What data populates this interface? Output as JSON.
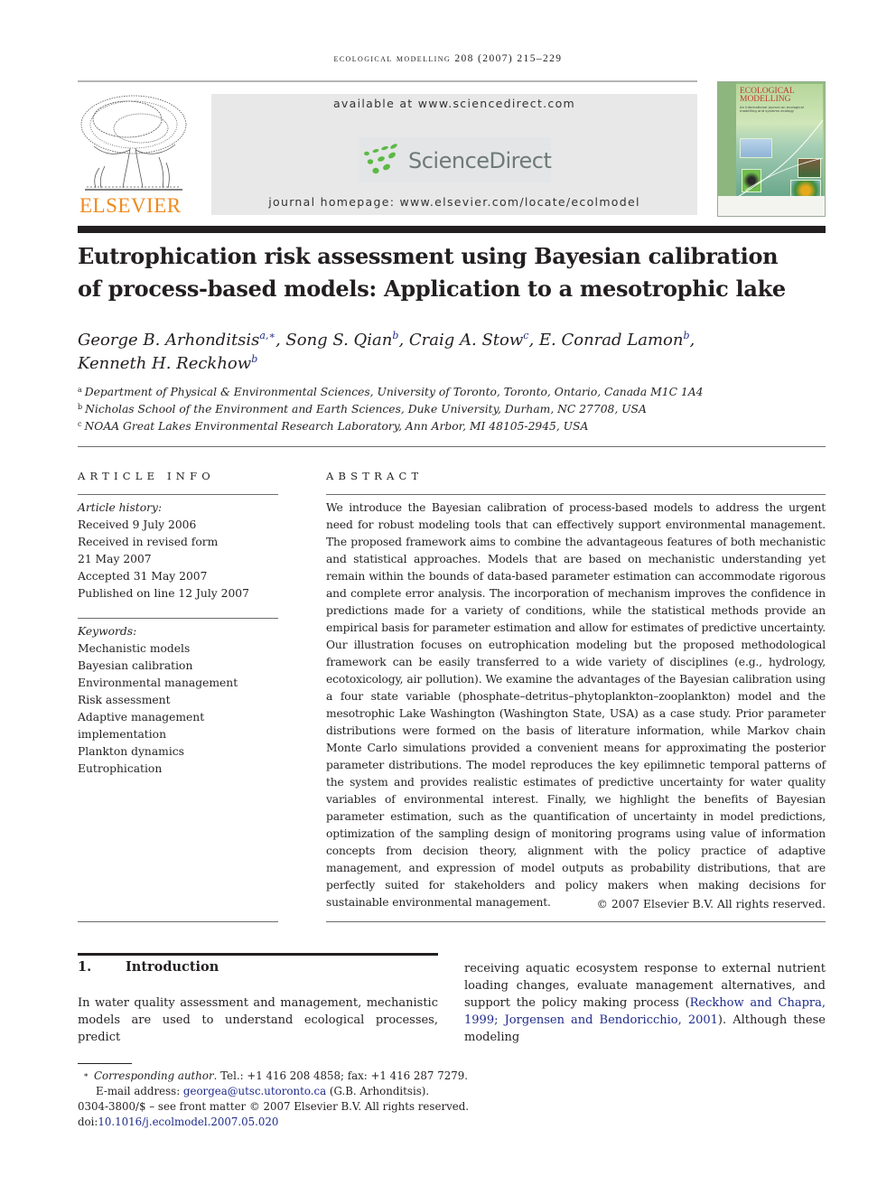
{
  "running_head": "ecological modelling 208 (2007) 215–229",
  "header": {
    "publisher": "ELSEVIER",
    "available_at": "available at www.sciencedirect.com",
    "sciencedirect_logo": "ScienceDirect",
    "journal_homepage": "journal homepage: www.elsevier.com/locate/ecolmodel",
    "cover": {
      "title_line1": "ECOLOGICAL",
      "title_line2": "MODELLING",
      "subtitle": "An international journal on ecological modelling and systems ecology"
    }
  },
  "colors": {
    "elsevier_orange": "#f08a1c",
    "sciencedirect_green": "#5cb946",
    "sciencedirect_gray": "#6f7a77",
    "link_blue": "#1e2a8a",
    "text": "#231f20"
  },
  "article": {
    "title_line1": "Eutrophication risk assessment using Bayesian calibration",
    "title_line2": "of process-based models: Application to a mesotrophic lake",
    "authors": [
      {
        "name": "George B. Arhonditsis",
        "sup": "a,∗",
        "sep": ", "
      },
      {
        "name": "Song S. Qian",
        "sup": "b",
        "sep": ", "
      },
      {
        "name": "Craig A. Stow",
        "sup": "c",
        "sep": ", "
      },
      {
        "name": "E. Conrad Lamon",
        "sup": "b",
        "sep": ","
      },
      {
        "name": "Kenneth H. Reckhow",
        "sup": "b",
        "sep": ""
      }
    ],
    "affiliations": [
      {
        "sup": "a",
        "text": "Department of Physical & Environmental Sciences, University of Toronto, Toronto, Ontario, Canada M1C 1A4"
      },
      {
        "sup": "b",
        "text": "Nicholas School of the Environment and Earth Sciences, Duke University, Durham, NC 27708, USA"
      },
      {
        "sup": "c",
        "text": "NOAA Great Lakes Environmental Research Laboratory, Ann Arbor, MI 48105-2945, USA"
      }
    ]
  },
  "article_info": {
    "heading": "ARTICLE INFO",
    "history_label": "Article history:",
    "history": [
      "Received 9 July 2006",
      "Received in revised form",
      "21 May 2007",
      "Accepted 31 May 2007",
      "Published on line 12 July 2007"
    ],
    "keywords_label": "Keywords:",
    "keywords": [
      "Mechanistic models",
      "Bayesian calibration",
      "Environmental management",
      "Risk assessment",
      "Adaptive management",
      "implementation",
      "Plankton dynamics",
      "Eutrophication"
    ]
  },
  "abstract": {
    "heading": "ABSTRACT",
    "text": "We introduce the Bayesian calibration of process-based models to address the urgent need for robust modeling tools that can effectively support environmental management. The proposed framework aims to combine the advantageous features of both mechanistic and statistical approaches. Models that are based on mechanistic understanding yet remain within the bounds of data-based parameter estimation can accommodate rigorous and complete error analysis. The incorporation of mechanism improves the confidence in predictions made for a variety of conditions, while the statistical methods provide an empirical basis for parameter estimation and allow for estimates of predictive uncertainty. Our illustration focuses on eutrophication modeling but the proposed methodological framework can be easily transferred to a wide variety of disciplines (e.g., hydrology, ecotoxicology, air pollution). We examine the advantages of the Bayesian calibration using a four state variable (phosphate–detritus–phytoplankton–zooplankton) model and the mesotrophic Lake Washington (Washington State, USA) as a case study. Prior parameter distributions were formed on the basis of literature information, while Markov chain Monte Carlo simulations provided a convenient means for approximating the posterior parameter distributions. The model reproduces the key epilimnetic temporal patterns of the system and provides realistic estimates of predictive uncertainty for water quality variables of environmental interest. Finally, we highlight the benefits of Bayesian parameter estimation, such as the quantification of uncertainty in model predictions, optimization of the sampling design of monitoring programs using value of information concepts from decision theory, alignment with the policy practice of adaptive management, and expression of model outputs as probability distributions, that are perfectly suited for stakeholders and policy makers when making decisions for sustainable environmental management.",
    "copyright": "© 2007 Elsevier B.V. All rights reserved."
  },
  "introduction": {
    "number": "1.",
    "heading": "Introduction",
    "left_text": "In water quality assessment and management, mechanistic models are used to understand ecological processes, predict",
    "right_text_before": "receiving aquatic ecosystem response to external nutrient loading changes, evaluate management alternatives, and support the policy making process (",
    "citation1": "Reckhow and Chapra, 1999;",
    "citation2": "Jorgensen and Bendoricchio, 2001",
    "right_text_after": "). Although these modeling"
  },
  "footnotes": {
    "star": "∗",
    "corresponding_label": "Corresponding author",
    "contact": ". Tel.: +1 416 208 4858; fax: +1 416 287 7279.",
    "email_label": "E-mail address: ",
    "email": "georgea@utsc.utoronto.ca",
    "email_owner": " (G.B. Arhonditsis).",
    "front_matter": "0304-3800/$ – see front matter © 2007 Elsevier B.V. All rights reserved.",
    "doi_label": "doi:",
    "doi": "10.1016/j.ecolmodel.2007.05.020"
  }
}
